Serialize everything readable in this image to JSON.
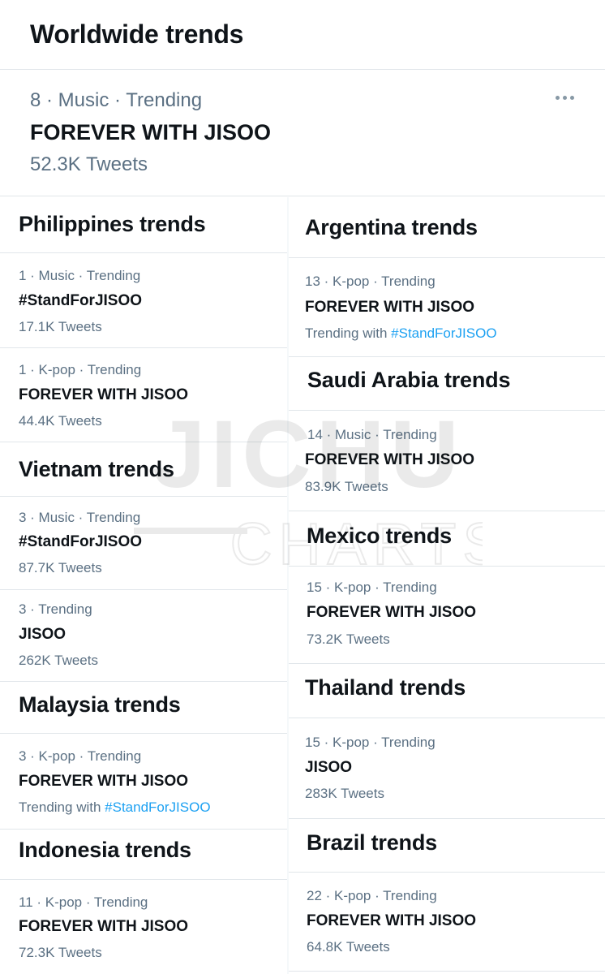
{
  "header": {
    "title": "Worldwide trends"
  },
  "featured": {
    "meta": "8 · Music · Trending",
    "name": "FOREVER WITH JISOO",
    "count": "52.3K Tweets"
  },
  "left_column": [
    {
      "title": "Philippines trends",
      "trends": [
        {
          "meta": "1 · Music · Trending",
          "name": "#StandForJISOO",
          "sub": "17.1K Tweets"
        },
        {
          "meta": "1 · K-pop · Trending",
          "name": "FOREVER WITH JISOO",
          "sub": "44.4K Tweets"
        }
      ]
    },
    {
      "title": "Vietnam trends",
      "trends": [
        {
          "meta": "3 · Music · Trending",
          "name": "#StandForJISOO",
          "sub": "87.7K Tweets"
        },
        {
          "meta": "3 · Trending",
          "name": "JISOO",
          "sub": "262K Tweets"
        }
      ]
    },
    {
      "title": "Malaysia trends",
      "trends": [
        {
          "meta": "3 · K-pop · Trending",
          "name": "FOREVER WITH JISOO",
          "sub_prefix": "Trending with ",
          "sub_link": "#StandForJISOO"
        }
      ]
    },
    {
      "title": "Indonesia trends",
      "trends": [
        {
          "meta": "11 · K-pop · Trending",
          "name": "FOREVER WITH JISOO",
          "sub": "72.3K Tweets"
        }
      ]
    }
  ],
  "right_column": [
    {
      "title": "Argentina trends",
      "trends": [
        {
          "meta": "13 · K-pop · Trending",
          "name": "FOREVER WITH JISOO",
          "sub_prefix": "Trending with ",
          "sub_link": "#StandForJISOO"
        }
      ]
    },
    {
      "title": "Saudi Arabia trends",
      "trends": [
        {
          "meta": "14 · Music · Trending",
          "name": "FOREVER WITH JISOO",
          "sub": "83.9K Tweets"
        }
      ]
    },
    {
      "title": "Mexico trends",
      "trends": [
        {
          "meta": "15 · K-pop · Trending",
          "name": "FOREVER WITH JISOO",
          "sub": "73.2K Tweets"
        }
      ]
    },
    {
      "title": "Thailand trends",
      "trends": [
        {
          "meta": "15 · K-pop · Trending",
          "name": "JISOO",
          "sub": "283K Tweets"
        }
      ]
    },
    {
      "title": "Brazil trends",
      "trends": [
        {
          "meta": "22 · K-pop · Trending",
          "name": "FOREVER WITH JISOO",
          "sub": "64.8K Tweets"
        }
      ]
    }
  ],
  "watermark": {
    "line1": "JICHU",
    "line2": "CHARTS"
  },
  "colors": {
    "text_primary": "#0f1419",
    "text_secondary": "#5b7083",
    "link": "#1da1f2",
    "divider": "#e1e6ea"
  },
  "icons": {
    "more": "more-dots-icon"
  }
}
